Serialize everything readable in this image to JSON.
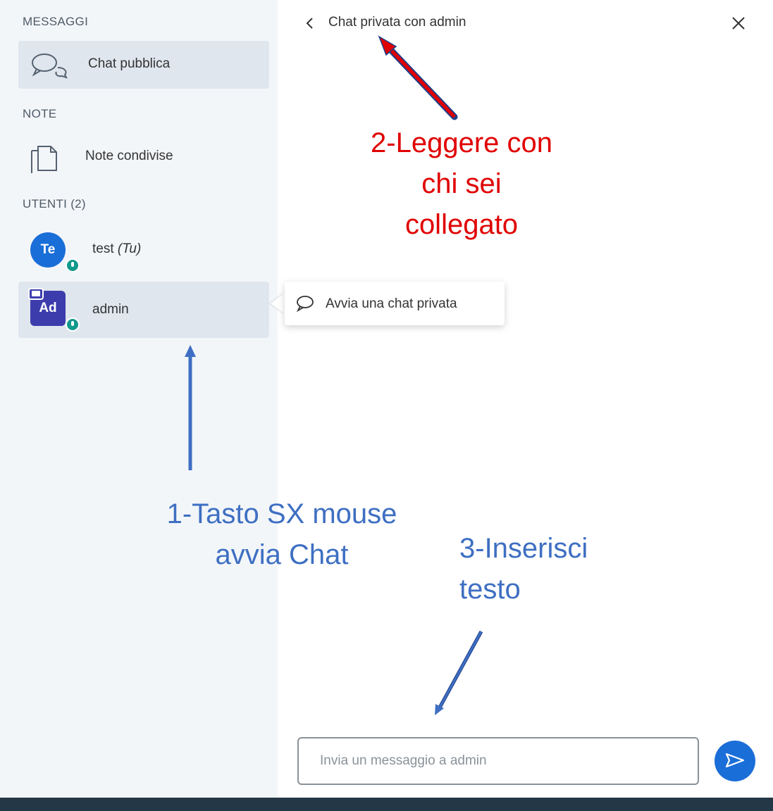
{
  "sidebar": {
    "messages_title": "MESSAGGI",
    "public_chat_label": "Chat pubblica",
    "notes_title": "NOTE",
    "shared_notes_label": "Note condivise",
    "users_title": "UTENTI (2)",
    "users": [
      {
        "initials": "Te",
        "name": "test",
        "suffix": "(Tu)"
      },
      {
        "initials": "Ad",
        "name": "admin"
      }
    ]
  },
  "tooltip": {
    "label": "Avvia una chat privata"
  },
  "chat": {
    "title": "Chat privata con admin",
    "input_placeholder": "Invia un messaggio a admin"
  },
  "annotations": {
    "step2": [
      "2-Leggere con",
      "chi sei",
      "collegato"
    ],
    "step1": [
      "1-Tasto SX mouse",
      "avvia Chat"
    ],
    "step3": [
      "3-Inserisci",
      "testo"
    ]
  },
  "colors": {
    "primary": "#1a6ed8",
    "presenter_avatar": "#3c3cad",
    "status_online": "#129a8c",
    "annotation_red": "#e00000",
    "annotation_blue": "#3e6fc2"
  },
  "icons": [
    "chat-bubbles-icon",
    "notes-icon",
    "chevron-left-icon",
    "close-icon",
    "chat-bubble-icon",
    "send-icon",
    "presenter-icon"
  ]
}
